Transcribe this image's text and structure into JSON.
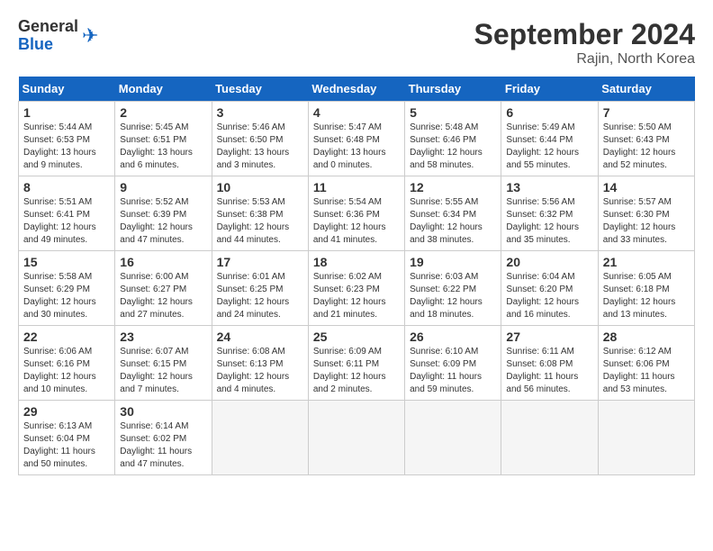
{
  "logo": {
    "general": "General",
    "blue": "Blue"
  },
  "title": "September 2024",
  "location": "Rajin, North Korea",
  "weekdays": [
    "Sunday",
    "Monday",
    "Tuesday",
    "Wednesday",
    "Thursday",
    "Friday",
    "Saturday"
  ],
  "days": [
    {
      "day": "",
      "empty": true
    },
    {
      "day": "",
      "empty": true
    },
    {
      "day": "",
      "empty": true
    },
    {
      "day": "",
      "empty": true
    },
    {
      "day": "",
      "empty": true
    },
    {
      "day": "",
      "empty": true
    },
    {
      "day": "1",
      "sunrise": "Sunrise: 5:44 AM",
      "sunset": "Sunset: 6:53 PM",
      "daylight": "Daylight: 13 hours and 9 minutes."
    },
    {
      "day": "2",
      "sunrise": "Sunrise: 5:45 AM",
      "sunset": "Sunset: 6:51 PM",
      "daylight": "Daylight: 13 hours and 6 minutes."
    },
    {
      "day": "3",
      "sunrise": "Sunrise: 5:46 AM",
      "sunset": "Sunset: 6:50 PM",
      "daylight": "Daylight: 13 hours and 3 minutes."
    },
    {
      "day": "4",
      "sunrise": "Sunrise: 5:47 AM",
      "sunset": "Sunset: 6:48 PM",
      "daylight": "Daylight: 13 hours and 0 minutes."
    },
    {
      "day": "5",
      "sunrise": "Sunrise: 5:48 AM",
      "sunset": "Sunset: 6:46 PM",
      "daylight": "Daylight: 12 hours and 58 minutes."
    },
    {
      "day": "6",
      "sunrise": "Sunrise: 5:49 AM",
      "sunset": "Sunset: 6:44 PM",
      "daylight": "Daylight: 12 hours and 55 minutes."
    },
    {
      "day": "7",
      "sunrise": "Sunrise: 5:50 AM",
      "sunset": "Sunset: 6:43 PM",
      "daylight": "Daylight: 12 hours and 52 minutes."
    },
    {
      "day": "8",
      "sunrise": "Sunrise: 5:51 AM",
      "sunset": "Sunset: 6:41 PM",
      "daylight": "Daylight: 12 hours and 49 minutes."
    },
    {
      "day": "9",
      "sunrise": "Sunrise: 5:52 AM",
      "sunset": "Sunset: 6:39 PM",
      "daylight": "Daylight: 12 hours and 47 minutes."
    },
    {
      "day": "10",
      "sunrise": "Sunrise: 5:53 AM",
      "sunset": "Sunset: 6:38 PM",
      "daylight": "Daylight: 12 hours and 44 minutes."
    },
    {
      "day": "11",
      "sunrise": "Sunrise: 5:54 AM",
      "sunset": "Sunset: 6:36 PM",
      "daylight": "Daylight: 12 hours and 41 minutes."
    },
    {
      "day": "12",
      "sunrise": "Sunrise: 5:55 AM",
      "sunset": "Sunset: 6:34 PM",
      "daylight": "Daylight: 12 hours and 38 minutes."
    },
    {
      "day": "13",
      "sunrise": "Sunrise: 5:56 AM",
      "sunset": "Sunset: 6:32 PM",
      "daylight": "Daylight: 12 hours and 35 minutes."
    },
    {
      "day": "14",
      "sunrise": "Sunrise: 5:57 AM",
      "sunset": "Sunset: 6:30 PM",
      "daylight": "Daylight: 12 hours and 33 minutes."
    },
    {
      "day": "15",
      "sunrise": "Sunrise: 5:58 AM",
      "sunset": "Sunset: 6:29 PM",
      "daylight": "Daylight: 12 hours and 30 minutes."
    },
    {
      "day": "16",
      "sunrise": "Sunrise: 6:00 AM",
      "sunset": "Sunset: 6:27 PM",
      "daylight": "Daylight: 12 hours and 27 minutes."
    },
    {
      "day": "17",
      "sunrise": "Sunrise: 6:01 AM",
      "sunset": "Sunset: 6:25 PM",
      "daylight": "Daylight: 12 hours and 24 minutes."
    },
    {
      "day": "18",
      "sunrise": "Sunrise: 6:02 AM",
      "sunset": "Sunset: 6:23 PM",
      "daylight": "Daylight: 12 hours and 21 minutes."
    },
    {
      "day": "19",
      "sunrise": "Sunrise: 6:03 AM",
      "sunset": "Sunset: 6:22 PM",
      "daylight": "Daylight: 12 hours and 18 minutes."
    },
    {
      "day": "20",
      "sunrise": "Sunrise: 6:04 AM",
      "sunset": "Sunset: 6:20 PM",
      "daylight": "Daylight: 12 hours and 16 minutes."
    },
    {
      "day": "21",
      "sunrise": "Sunrise: 6:05 AM",
      "sunset": "Sunset: 6:18 PM",
      "daylight": "Daylight: 12 hours and 13 minutes."
    },
    {
      "day": "22",
      "sunrise": "Sunrise: 6:06 AM",
      "sunset": "Sunset: 6:16 PM",
      "daylight": "Daylight: 12 hours and 10 minutes."
    },
    {
      "day": "23",
      "sunrise": "Sunrise: 6:07 AM",
      "sunset": "Sunset: 6:15 PM",
      "daylight": "Daylight: 12 hours and 7 minutes."
    },
    {
      "day": "24",
      "sunrise": "Sunrise: 6:08 AM",
      "sunset": "Sunset: 6:13 PM",
      "daylight": "Daylight: 12 hours and 4 minutes."
    },
    {
      "day": "25",
      "sunrise": "Sunrise: 6:09 AM",
      "sunset": "Sunset: 6:11 PM",
      "daylight": "Daylight: 12 hours and 2 minutes."
    },
    {
      "day": "26",
      "sunrise": "Sunrise: 6:10 AM",
      "sunset": "Sunset: 6:09 PM",
      "daylight": "Daylight: 11 hours and 59 minutes."
    },
    {
      "day": "27",
      "sunrise": "Sunrise: 6:11 AM",
      "sunset": "Sunset: 6:08 PM",
      "daylight": "Daylight: 11 hours and 56 minutes."
    },
    {
      "day": "28",
      "sunrise": "Sunrise: 6:12 AM",
      "sunset": "Sunset: 6:06 PM",
      "daylight": "Daylight: 11 hours and 53 minutes."
    },
    {
      "day": "29",
      "sunrise": "Sunrise: 6:13 AM",
      "sunset": "Sunset: 6:04 PM",
      "daylight": "Daylight: 11 hours and 50 minutes."
    },
    {
      "day": "30",
      "sunrise": "Sunrise: 6:14 AM",
      "sunset": "Sunset: 6:02 PM",
      "daylight": "Daylight: 11 hours and 47 minutes."
    },
    {
      "day": "",
      "empty": true
    },
    {
      "day": "",
      "empty": true
    },
    {
      "day": "",
      "empty": true
    },
    {
      "day": "",
      "empty": true
    },
    {
      "day": "",
      "empty": true
    }
  ]
}
